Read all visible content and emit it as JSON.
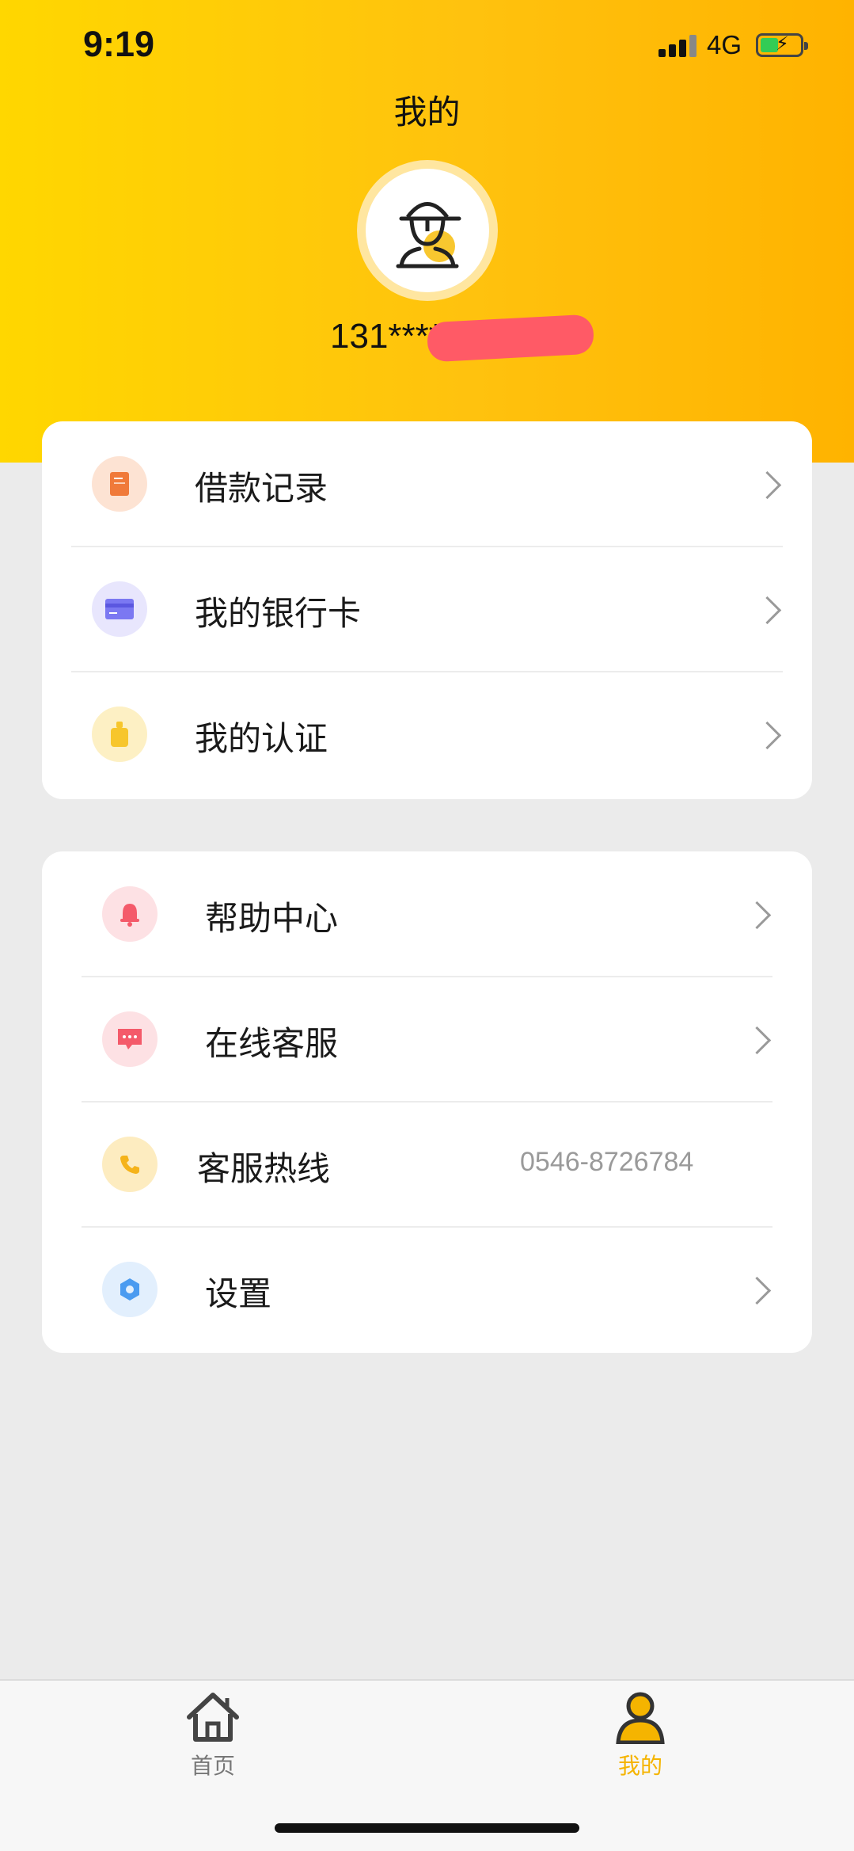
{
  "status_bar": {
    "time": "9:19",
    "network": "4G"
  },
  "header": {
    "title": "我的",
    "phone_visible": "131****"
  },
  "menu_group_1": [
    {
      "label": "借款记录",
      "icon": "document-icon",
      "icon_color": "#f07a3a",
      "icon_bg": "#fde3d3"
    },
    {
      "label": "我的银行卡",
      "icon": "bank-card-icon",
      "icon_color": "#7b78f2",
      "icon_bg": "#e8e6fd"
    },
    {
      "label": "我的认证",
      "icon": "id-badge-icon",
      "icon_color": "#f7c62c",
      "icon_bg": "#fdf0c4"
    }
  ],
  "menu_group_2": [
    {
      "label": "帮助中心",
      "icon": "bell-icon",
      "icon_color": "#f45a6a",
      "icon_bg": "#fde1e4"
    },
    {
      "label": "在线客服",
      "icon": "chat-bubble-icon",
      "icon_color": "#f45a6a",
      "icon_bg": "#fde1e4"
    },
    {
      "label": "客服热线",
      "icon": "phone-icon",
      "icon_color": "#f5b31a",
      "icon_bg": "#fdecc0",
      "value": "0546-8726784"
    },
    {
      "label": "设置",
      "icon": "settings-hexagon-icon",
      "icon_color": "#4b9bf0",
      "icon_bg": "#e2effd"
    }
  ],
  "tabbar": [
    {
      "label": "首页",
      "icon": "home-icon",
      "active": false
    },
    {
      "label": "我的",
      "icon": "user-icon",
      "active": true
    }
  ],
  "colors": {
    "accent": "#ffc20e",
    "active_tab": "#f5b400",
    "inactive_tab": "#777777"
  }
}
